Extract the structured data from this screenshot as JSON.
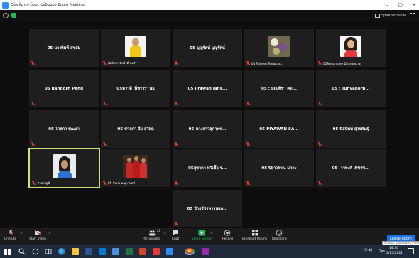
{
  "window": {
    "title": "Οὐκ ἔστιν ἔρως οὐδαμοῦ Zoom Meeting",
    "controls": {
      "minimize": "–",
      "maximize": "▢",
      "close": "✕"
    }
  },
  "top_bar": {
    "speaker_view_label": "Speaker View"
  },
  "tiles": [
    {
      "name": "05 นางพิมพ์ สุขสม",
      "label": "",
      "avatar": ""
    },
    {
      "name": "",
      "label": "(admin)ทิพย์วดี ดงศิร",
      "avatar": "yellow"
    },
    {
      "name": "05-บุญรัตน์ บุญรัตน์",
      "label": "",
      "avatar": ""
    },
    {
      "name": "",
      "label": "05 Faiporn Tempras...",
      "avatar": "fruit"
    },
    {
      "name": "",
      "label": "05Rungrudee Ditteancha",
      "avatar": "woman"
    },
    {
      "name": "05 Bangorn Peng",
      "label": "",
      "avatar": ""
    },
    {
      "name": "05ทวาดี เพ็ชรวราวณ",
      "label": "",
      "avatar": ""
    },
    {
      "name": "05 Jirawan Jans...",
      "label": "",
      "avatar": ""
    },
    {
      "name": "05 : มณฑิชา คด...",
      "label": "",
      "avatar": ""
    },
    {
      "name": "05 : Tunyaporn...",
      "label": "",
      "avatar": ""
    },
    {
      "name": "05 โกลกา พัฒนา",
      "label": "",
      "avatar": ""
    },
    {
      "name": "05 ชาลกา อึ่ม สวัสดุ",
      "label": "",
      "avatar": ""
    },
    {
      "name": "05-นางสาวสุภาพร...",
      "label": "",
      "avatar": ""
    },
    {
      "name": "05-PIYAWAN SA...",
      "label": "",
      "avatar": ""
    },
    {
      "name": "05 นิสนันท์ สุวรพันธุ์",
      "label": "",
      "avatar": ""
    },
    {
      "name": "",
      "label": "ชาม่าปฐมี",
      "avatar": "portrait"
    },
    {
      "name": "",
      "label": "05 ชินกร มณุกานตรี",
      "avatar": "group"
    },
    {
      "name": "05สุชาดา ทวีเชื้อ ร...",
      "label": "",
      "avatar": ""
    },
    {
      "name": "05 ปิยาวรรณ มากะ",
      "label": "",
      "avatar": ""
    },
    {
      "name": "05- วาพงศ์ เพ็ชรัช...",
      "label": "",
      "avatar": ""
    },
    {
      "name": "05 นำยวัชรพาวนแล...",
      "label": "",
      "avatar": ""
    }
  ],
  "toolbar": {
    "unmute": "Unmute",
    "start_video": "Start Video",
    "participants": "Participants",
    "participants_count": "21",
    "chat": "Chat",
    "share_screen": "Share Screen",
    "record": "Record",
    "breakout_rooms": "Breakout Rooms",
    "reactions": "Reactions",
    "leave_room": "Leave Room",
    "tooltip": "วันจันทร์, กุมภาพันธ์ 15, 2021"
  },
  "taskbar": {
    "lang": "ไทย",
    "time": "14:30",
    "date": "2/15/2021"
  },
  "colors": {
    "accent_blue": "#1a73e8",
    "share_green": "#20b954",
    "active_border": "#d6e37a",
    "mute_red": "#e53935",
    "tile_bg": "#1e1e1e"
  }
}
